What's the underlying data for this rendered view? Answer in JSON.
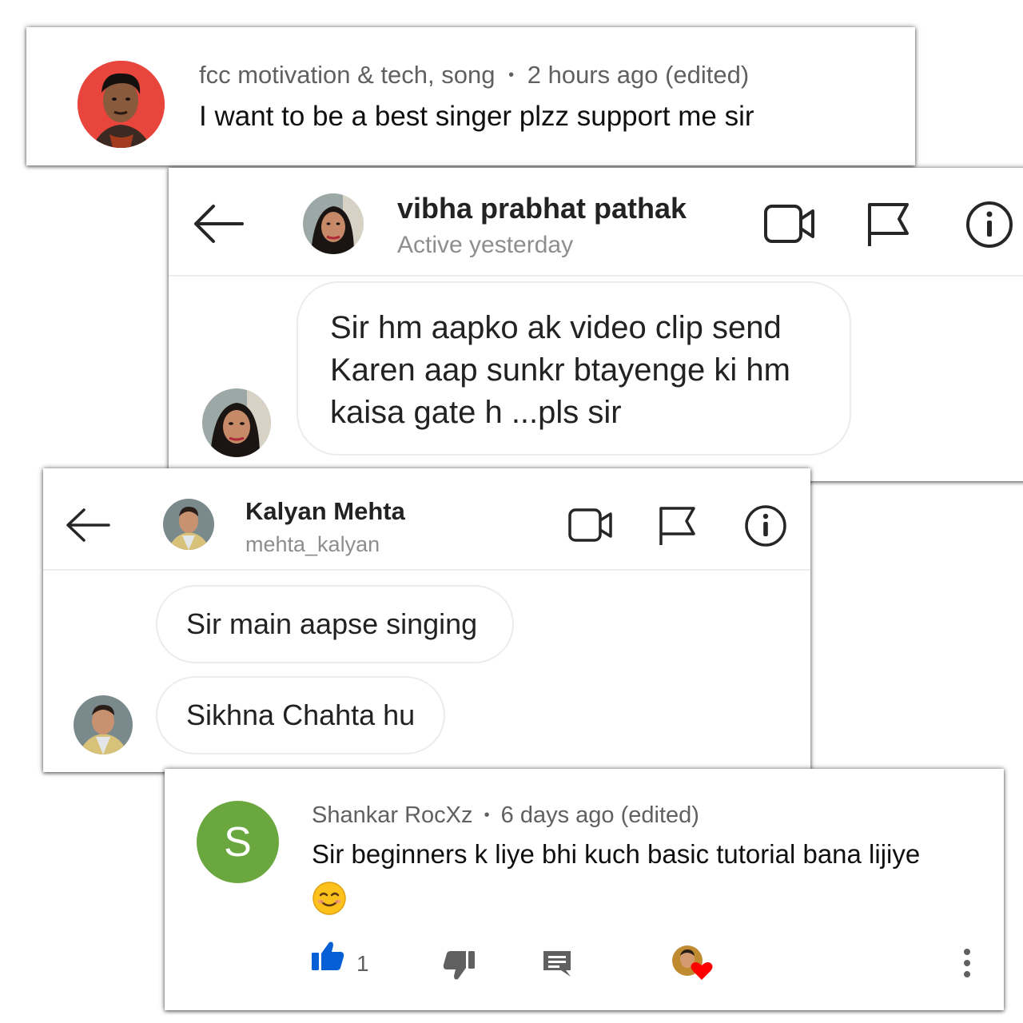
{
  "comment1": {
    "author": "fcc motivation & tech, song",
    "separator": "•",
    "time": "2 hours ago (edited)",
    "text": "I want to be a best singer plzz support me sir"
  },
  "dm1": {
    "name": "vibha prabhat pathak",
    "status": "Active yesterday",
    "message_lines": [
      "Sir hm aapko ak video clip send",
      "Karen aap sunkr btayenge ki hm",
      "kaisa gate h ...pls sir"
    ],
    "icons": [
      "back-arrow-icon",
      "video-camera-icon",
      "flag-icon",
      "info-icon"
    ]
  },
  "dm2": {
    "name": "Kalyan Mehta",
    "username": "mehta_kalyan",
    "messages": [
      "Sir main aapse singing",
      "Sikhna Chahta hu"
    ],
    "icons": [
      "back-arrow-icon",
      "video-camera-icon",
      "flag-icon",
      "info-icon"
    ]
  },
  "comment2": {
    "author": "Shankar RocXz",
    "separator": "•",
    "time": "6 days ago (edited)",
    "text": "Sir beginners k liye bhi kuch basic tutorial bana lijiye",
    "emoji": "smiling-face-emoji",
    "avatar_letter": "S",
    "avatar_color": "#6aa83f",
    "like_count": "1",
    "like_color": "#065fd4",
    "heart_color": "#ff0000",
    "icons": [
      "thumbs-up-icon",
      "thumbs-down-icon",
      "reply-icon",
      "creator-heart-icon",
      "more-vert-icon"
    ]
  }
}
